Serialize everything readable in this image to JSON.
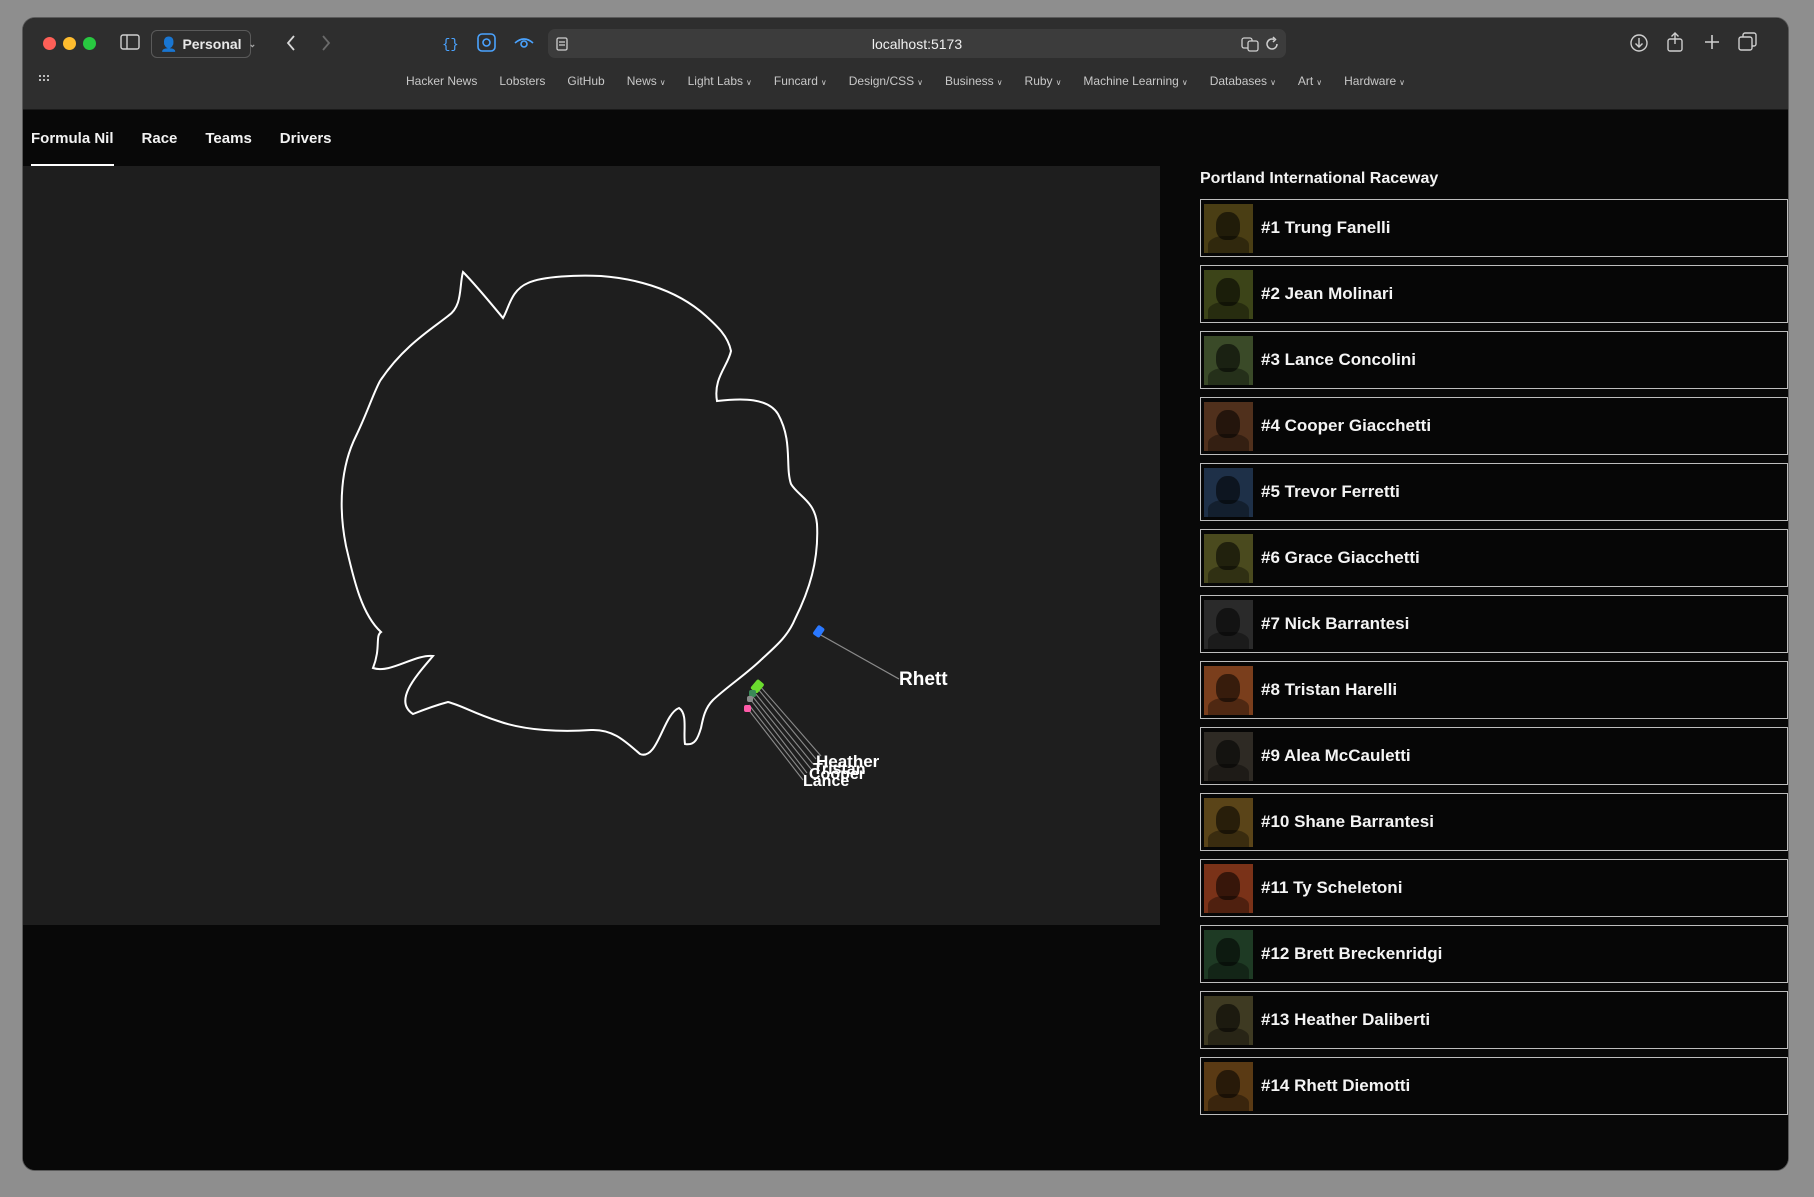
{
  "browser": {
    "profile": "Personal",
    "url": "localhost:5173",
    "bookmarks": [
      {
        "label": "Hacker News",
        "menu": false
      },
      {
        "label": "Lobsters",
        "menu": false
      },
      {
        "label": "GitHub",
        "menu": false
      },
      {
        "label": "News",
        "menu": true
      },
      {
        "label": "Light Labs",
        "menu": true
      },
      {
        "label": "Funcard",
        "menu": true
      },
      {
        "label": "Design/CSS",
        "menu": true
      },
      {
        "label": "Business",
        "menu": true
      },
      {
        "label": "Ruby",
        "menu": true
      },
      {
        "label": "Machine Learning",
        "menu": true
      },
      {
        "label": "Databases",
        "menu": true
      },
      {
        "label": "Art",
        "menu": true
      },
      {
        "label": "Hardware",
        "menu": true
      }
    ]
  },
  "nav": {
    "tabs": [
      "Formula Nil",
      "Race",
      "Teams",
      "Drivers"
    ],
    "active": "Formula Nil"
  },
  "race": {
    "track_name": "Portland International Raceway",
    "labels": {
      "rhett": "Rhett",
      "cluster_top": "Heather",
      "cluster_mid": "Tristan",
      "cluster_low": "Cooper",
      "cluster_bottom": "Lance"
    }
  },
  "drivers": [
    {
      "label": "#1 Trung Fanelli",
      "tint": "#4a3e14"
    },
    {
      "label": "#2 Jean Molinari",
      "tint": "#3c4418"
    },
    {
      "label": "#3 Lance Concolini",
      "tint": "#3a4a28"
    },
    {
      "label": "#4 Cooper Giacchetti",
      "tint": "#50301c"
    },
    {
      "label": "#5 Trevor Ferretti",
      "tint": "#1e3048"
    },
    {
      "label": "#6 Grace Giacchetti",
      "tint": "#4a4a1e"
    },
    {
      "label": "#7 Nick Barrantesi",
      "tint": "#2a2a2a"
    },
    {
      "label": "#8 Tristan Harelli",
      "tint": "#7a3e1c"
    },
    {
      "label": "#9 Alea McCauletti",
      "tint": "#2e2a24"
    },
    {
      "label": "#10 Shane Barrantesi",
      "tint": "#5a4418"
    },
    {
      "label": "#11 Ty Scheletoni",
      "tint": "#7a3218"
    },
    {
      "label": "#12 Brett Breckenridgi",
      "tint": "#1e3a24"
    },
    {
      "label": "#13 Heather Daliberti",
      "tint": "#3e3a22"
    },
    {
      "label": "#14 Rhett Diemotti",
      "tint": "#5a3a14"
    }
  ]
}
